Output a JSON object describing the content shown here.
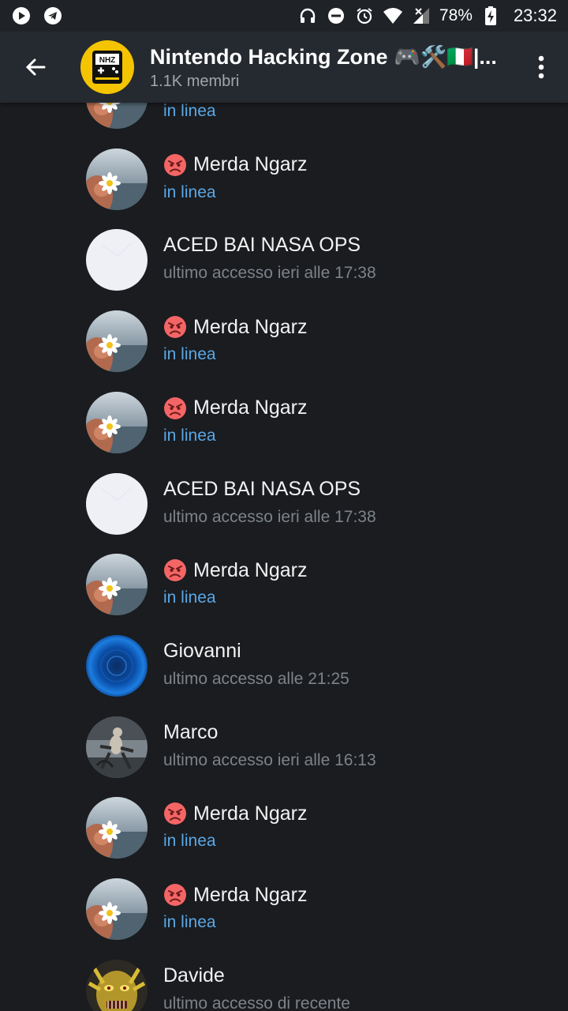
{
  "status_bar": {
    "battery": "78%",
    "time": "23:32",
    "colors": {
      "bg": "#1f2328"
    }
  },
  "header": {
    "title": "Nintendo Hacking Zone 🎮🛠️🇮🇹|...",
    "subtitle": "1.1K membri",
    "avatar_text": "NHZ",
    "colors": {
      "bg": "#252a30",
      "avatar": "#f5c400"
    }
  },
  "members": [
    {
      "name": "",
      "status": "in linea",
      "online": true,
      "avatar": "flower",
      "emoji": false
    },
    {
      "name": "Merda Ngarz",
      "status": "in linea",
      "online": true,
      "avatar": "flower",
      "emoji": true
    },
    {
      "name": "ACED BAI NASA OPS",
      "status": "ultimo accesso ieri alle 17:38",
      "online": false,
      "avatar": "white",
      "emoji": false
    },
    {
      "name": "Merda Ngarz",
      "status": "in linea",
      "online": true,
      "avatar": "flower",
      "emoji": true
    },
    {
      "name": "Merda Ngarz",
      "status": "in linea",
      "online": true,
      "avatar": "flower",
      "emoji": true
    },
    {
      "name": "ACED BAI NASA OPS",
      "status": "ultimo accesso ieri alle 17:38",
      "online": false,
      "avatar": "white",
      "emoji": false
    },
    {
      "name": "Merda Ngarz",
      "status": "in linea",
      "online": true,
      "avatar": "flower",
      "emoji": true
    },
    {
      "name": "Giovanni",
      "status": "ultimo accesso alle 21:25",
      "online": false,
      "avatar": "blue",
      "emoji": false
    },
    {
      "name": "Marco",
      "status": "ultimo accesso ieri alle 16:13",
      "online": false,
      "avatar": "marco",
      "emoji": false
    },
    {
      "name": "Merda Ngarz",
      "status": "in linea",
      "online": true,
      "avatar": "flower",
      "emoji": true
    },
    {
      "name": "Merda Ngarz",
      "status": "in linea",
      "online": true,
      "avatar": "flower",
      "emoji": true
    },
    {
      "name": "Davide",
      "status": "ultimo accesso di recente",
      "online": false,
      "avatar": "davide",
      "emoji": false
    }
  ],
  "colors": {
    "background": "#1a1c20",
    "online": "#5aa8e6",
    "offline": "#7d8389"
  }
}
